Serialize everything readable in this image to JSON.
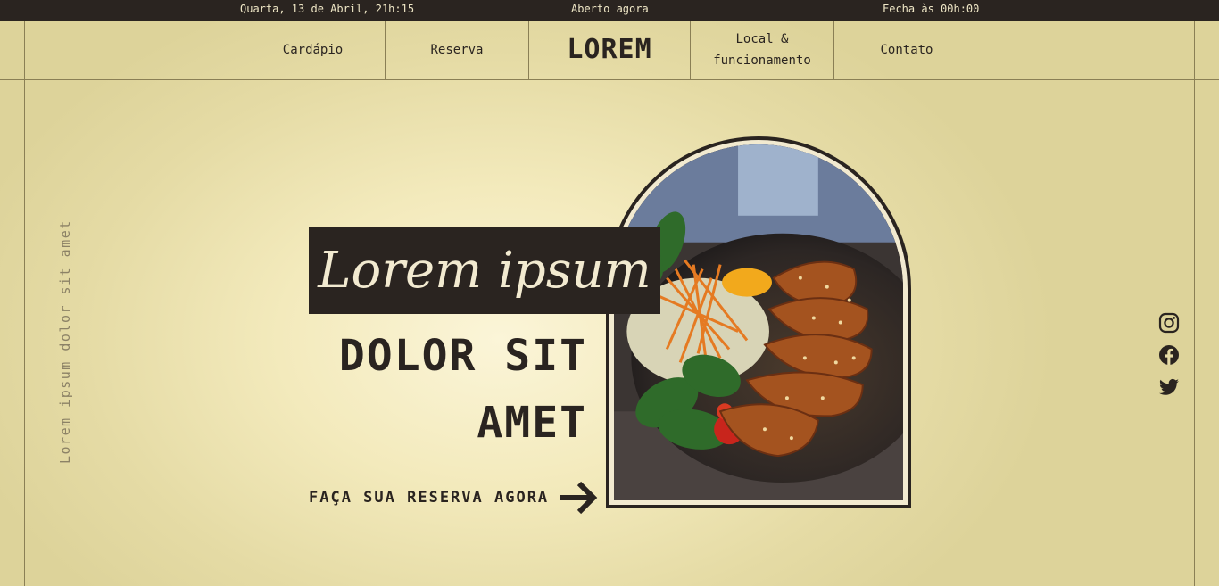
{
  "topbar": {
    "date": "Quarta, 13 de Abril, 21h:15",
    "status": "Aberto agora",
    "closes": "Fecha às 00h:00"
  },
  "nav": {
    "menu": "Cardápio",
    "reserve": "Reserva",
    "brand": "LOREM",
    "location_line1": "Local &",
    "location_line2": "funcionamento",
    "contact": "Contato"
  },
  "side_text": "Lorem ipsum dolor sit amet",
  "hero": {
    "script_title": "Lorem ipsum",
    "headline_line1": "DOLOR SIT",
    "headline_line2": "AMET",
    "cta": "FAÇA SUA RESERVA AGORA"
  },
  "social": [
    "instagram-icon",
    "facebook-icon",
    "twitter-icon"
  ],
  "colors": {
    "dark": "#2a2420",
    "cream": "#f2ead0",
    "background": "#e5dba5"
  }
}
